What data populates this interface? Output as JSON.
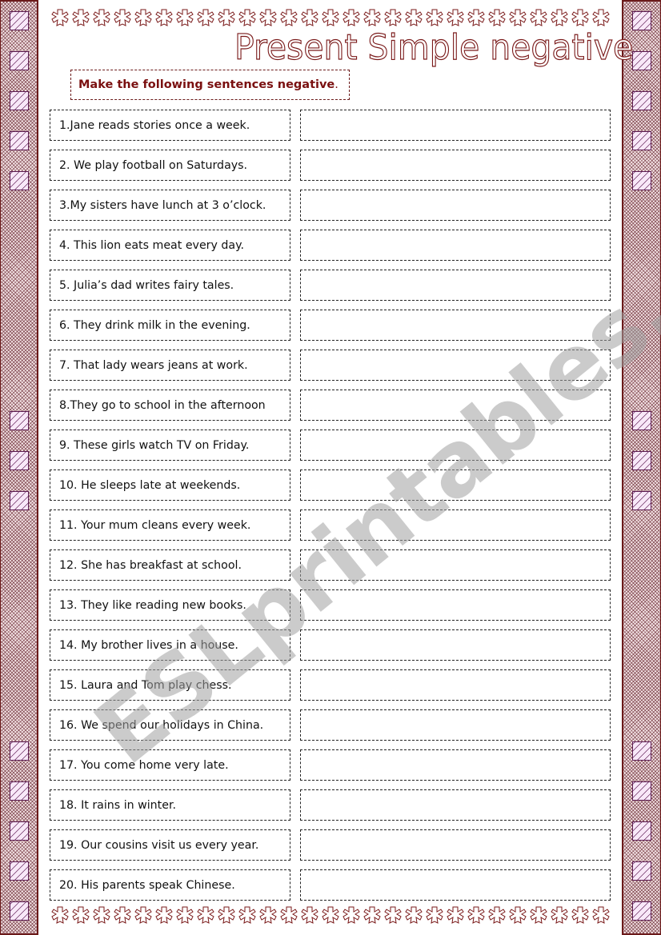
{
  "worksheet": {
    "title": "Present Simple negative",
    "instruction": "Make the following sentences negative",
    "instruction_end": ".",
    "watermark": "ESLprintables.com",
    "colors": {
      "accent": "#7a1010",
      "border": "#6b1a1a",
      "square_fill": "#f8e8f8",
      "square_line": "#5a1a50"
    },
    "decorations": {
      "side_border_icon": "patterned-border",
      "square_icon": "hatched-square",
      "flower_icon": "flower-outline"
    },
    "sentences": [
      {
        "text": "1.Jane reads stories once a week.",
        "answer": ""
      },
      {
        "text": "2. We play football on Saturdays.",
        "answer": ""
      },
      {
        "text": "3.My sisters have lunch at 3 o’clock.",
        "answer": ""
      },
      {
        "text": "4. This lion eats meat every day.",
        "answer": ""
      },
      {
        "text": "5. Julia’s dad writes fairy tales.",
        "answer": ""
      },
      {
        "text": "6. They drink milk in the evening.",
        "answer": ""
      },
      {
        "text": "7. That lady wears jeans at work.",
        "answer": ""
      },
      {
        "text": "8.They go to school in the afternoon",
        "answer": ""
      },
      {
        "text": "9. These girls watch TV on Friday.",
        "answer": ""
      },
      {
        "text": "10. He sleeps late at weekends.",
        "answer": ""
      },
      {
        "text": "11. Your mum cleans every week.",
        "answer": ""
      },
      {
        "text": "12. She has breakfast at school.",
        "answer": ""
      },
      {
        "text": "13. They like reading new books.",
        "answer": ""
      },
      {
        "text": "14. My brother lives in a house.",
        "answer": ""
      },
      {
        "text": "15. Laura and Tom play chess.",
        "answer": ""
      },
      {
        "text": "16. We spend our holidays in China.",
        "answer": ""
      },
      {
        "text": "17. You come home very late.",
        "answer": ""
      },
      {
        "text": "18. It rains in winter.",
        "answer": ""
      },
      {
        "text": "19. Our cousins visit us every year.",
        "answer": ""
      },
      {
        "text": "20. His parents speak Chinese.",
        "answer": ""
      }
    ]
  }
}
